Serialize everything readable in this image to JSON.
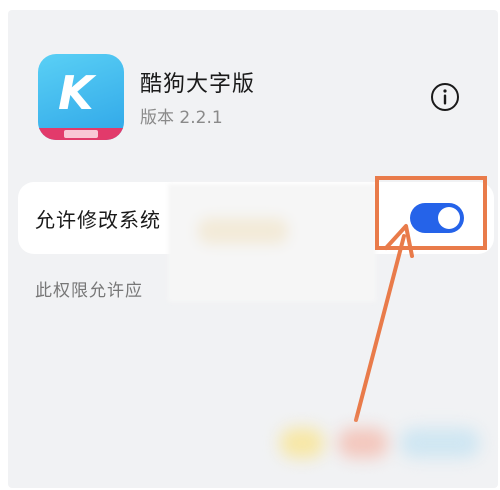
{
  "app": {
    "name": "酷狗大字版",
    "version": "版本 2.2.1",
    "icon_letter": "K",
    "icon_name": "app-icon"
  },
  "setting": {
    "label": "允许修改系统",
    "description": "此权限允许应",
    "toggle_state": "on"
  },
  "colors": {
    "toggle_on": "#2563e9",
    "highlight": "#e97b4a",
    "app_icon": "#2fa6e8"
  },
  "icons": {
    "info": "info-icon"
  }
}
